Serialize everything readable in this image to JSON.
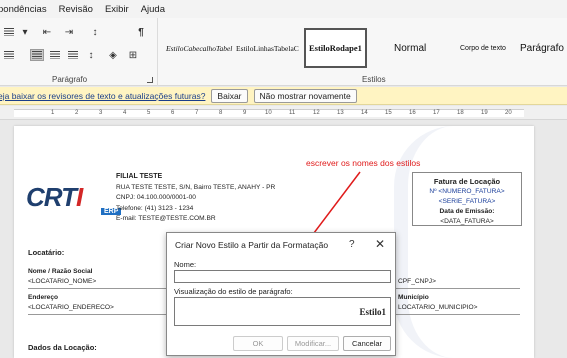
{
  "ribbon_tabs": [
    "pondências",
    "Revisão",
    "Exibir",
    "Ajuda"
  ],
  "paragraph_group": {
    "label": "Parágrafo"
  },
  "styles_group": {
    "label": "Estilos",
    "items": [
      "EstiloCabecalhoTabel",
      "EstiloLinhasTabelaC",
      "EstiloRodape1",
      "Normal",
      "Corpo de texto",
      "Parágrafo c"
    ]
  },
  "infobar": {
    "message": "eja baixar os revisores de texto e atualizações futuras?",
    "download_label": "Baixar",
    "dismiss_label": "Não mostrar novamente"
  },
  "ruler": {
    "numbers": [
      "1",
      "2",
      "3",
      "4",
      "5",
      "6",
      "7",
      "8",
      "9",
      "10",
      "11",
      "12",
      "13",
      "14",
      "15",
      "16",
      "17",
      "18",
      "19",
      "20"
    ]
  },
  "document": {
    "logo": {
      "main": "CRT",
      "accent": "I",
      "badge": "ERP"
    },
    "company": {
      "name": "FILIAL TESTE",
      "address": "RUA TESTE TESTE, S/N, Bairro TESTE, ANAHY - PR",
      "cnpj": "CNPJ:  04.100.000/0001-00",
      "phone": "Telefone: (41) 3123 - 1234",
      "email": "E-mail: TESTE@TESTE.COM.BR"
    },
    "annotation": "escrever os nomes dos estilos",
    "annotation_color": "#e01b1b",
    "invoice_box": {
      "title": "Fatura de Locação",
      "number": "Nº <NUMERO_FATURA>",
      "series": "<SERIE_FATURA>",
      "issue_label": "Data de Emissão:",
      "issue_value": "<DATA_FATURA>"
    },
    "locatario_heading": "Locatário:",
    "name_label": "Nome / Razão Social",
    "name_value": "<LOCATARIO_NOME>",
    "cpf_value": "CPF_CNPJ>",
    "address_label": "Endereço",
    "address_value": "<LOCATARIO_ENDERECO>",
    "city_label": "Município",
    "city_value": "LOCATARIO_MUNICIPIO>",
    "rental_heading": "Dados da Locação:"
  },
  "dialog": {
    "title": "Criar Novo Estilo a Partir da Formatação",
    "help": "?",
    "close": "✕",
    "name_label": "Nome:",
    "name_value": "",
    "preview_label": "Visualização do estilo de parágrafo:",
    "preview_text": "Estilo1",
    "ok_label": "OK",
    "modify_label": "Modificar...",
    "cancel_label": "Cancelar"
  }
}
